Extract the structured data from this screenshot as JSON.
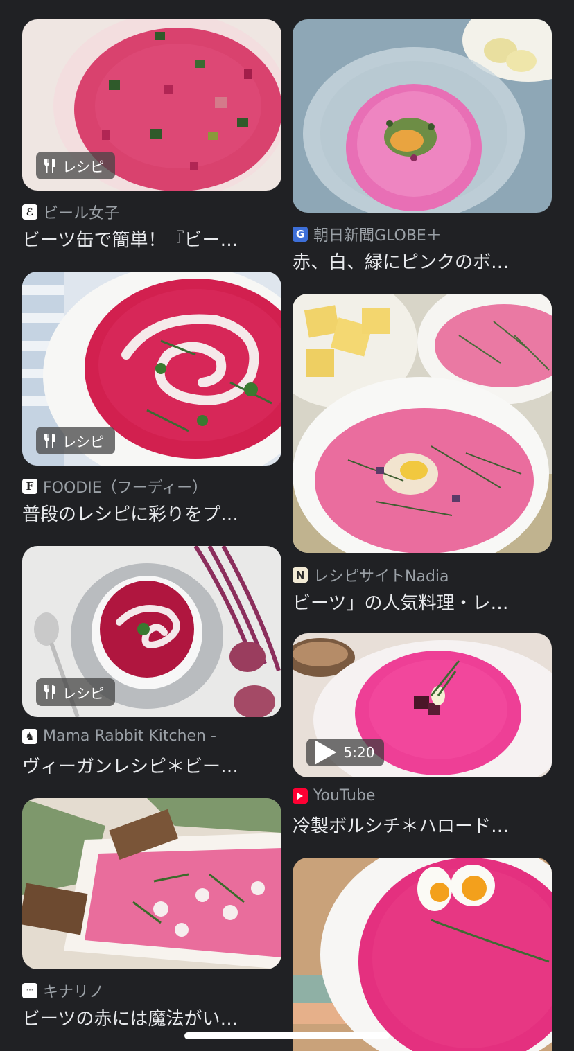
{
  "colors": {
    "background": "#202124",
    "title": "#e8eaed",
    "source": "#9aa0a6",
    "accent_pink": "#e0357a"
  },
  "badge": {
    "recipe_label": "レシピ"
  },
  "results": [
    {
      "source": "ビール女子",
      "title": "ビーツ缶で簡単！『ビー…",
      "favicon": "beer-girl-icon",
      "badge": "recipe"
    },
    {
      "source": "朝日新聞GLOBE＋",
      "title": "赤、白、緑にピンクのボ…",
      "favicon": "globe-g-icon",
      "badge": "none"
    },
    {
      "source": "FOODIE（フーディー）",
      "title": "普段のレシピに彩りをプ…",
      "favicon": "foodie-f-icon",
      "badge": "recipe"
    },
    {
      "source": "レシピサイトNadia",
      "title": "ビーツ」の人気料理・レ…",
      "favicon": "nadia-n-icon",
      "badge": "none"
    },
    {
      "source": "Mama Rabbit Kitchen -",
      "title": "ヴィーガンレシピ＊ビー…",
      "favicon": "rabbit-icon",
      "badge": "recipe"
    },
    {
      "source": "YouTube",
      "title": "冷製ボルシチ＊ハロード…",
      "favicon": "youtube-icon",
      "badge": "video",
      "duration": "5:20"
    },
    {
      "source": "キナリノ",
      "title": "ビーツの赤には魔法がい…",
      "favicon": "kinarino-icon",
      "badge": "none"
    },
    {
      "source": "",
      "title": "",
      "favicon": "",
      "badge": "none"
    }
  ]
}
